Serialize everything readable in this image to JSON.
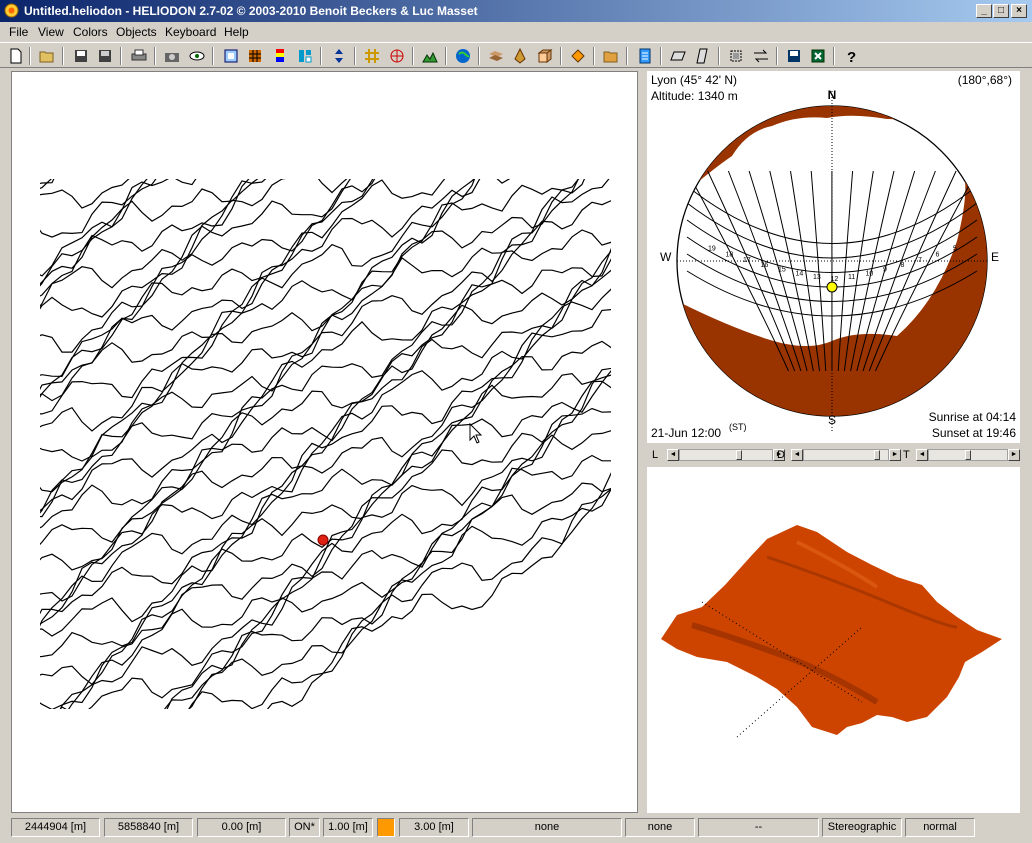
{
  "window": {
    "title": "Untitled.heliodon  -  HELIODON 2.7-02 © 2003-2010 Benoit Beckers & Luc Masset"
  },
  "menu": [
    "File",
    "View",
    "Colors",
    "Objects",
    "Keyboard",
    "Help"
  ],
  "toolbar_icons": [
    "new-file-icon",
    "open-folder-icon",
    "save-icon",
    "save-as-icon",
    "print-icon",
    "camera-icon",
    "eye-icon",
    "frame-icon",
    "grid-color-icon",
    "palette-icon",
    "tiles-icon",
    "vertical-arrows-icon",
    "grid-icon",
    "compass-icon",
    "terrain-icon",
    "globe-icon",
    "layers-icon",
    "shape-icon",
    "box-icon",
    "diamond-icon",
    "open-folder-icon-2",
    "document-icon",
    "plane-icon",
    "slanted-plane-icon",
    "transform-icon",
    "swap-icon",
    "disk-icon",
    "excel-icon",
    "help-icon"
  ],
  "sun_panel": {
    "location": "Lyon (45° 42' N)",
    "altitude": "Altitude: 1340 m",
    "angles": "(180°,68°)",
    "north": "N",
    "south": "S",
    "east": "E",
    "west": "W",
    "date": "21-Jun 12:00",
    "time_mode": "(ST)",
    "sunrise": "Sunrise at 04:14",
    "sunset": "Sunset at 19:46",
    "hours": [
      "5",
      "6",
      "7",
      "8",
      "9",
      "10",
      "11",
      "12",
      "13",
      "14",
      "15",
      "16",
      "17",
      "18",
      "19"
    ],
    "sun_color": "#ffff00",
    "mask_color": "#993300"
  },
  "sliders": {
    "l": "L",
    "d": "D",
    "t": "T"
  },
  "view3d": {
    "terrain_color": "#cc4400"
  },
  "status": {
    "x": "2444904 [m]",
    "y": "5858840 [m]",
    "z": "0.00 [m]",
    "mode": "ON*",
    "step": "1.00 [m]",
    "color": "#ff9900",
    "height": "3.00 [m]",
    "field1": "none",
    "field2": "none",
    "field3": "--",
    "projection": "Stereographic",
    "quality": "normal"
  }
}
